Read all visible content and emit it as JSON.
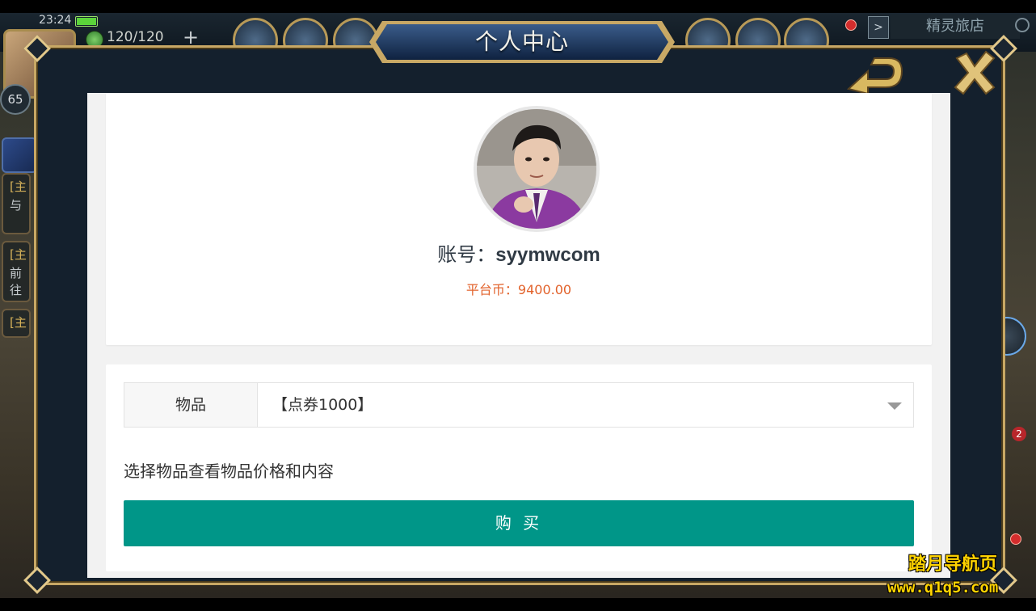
{
  "status_bar": {
    "time": "23:24",
    "stamina": "120/120",
    "plus": "+",
    "level": "65"
  },
  "game_hud": {
    "shop_name": "精灵旅店",
    "shop_arrow": ">",
    "quests": [
      {
        "tag": "[主",
        "text": "与"
      },
      {
        "tag": "[主",
        "text": "前往"
      },
      {
        "tag": "[主",
        "text": ""
      }
    ],
    "notification_count": "2"
  },
  "dialog": {
    "title": "个人中心"
  },
  "profile": {
    "account_label": "账号：",
    "account_value": "syymwcom",
    "coins_label": "平台币：",
    "coins_value": "9400.00"
  },
  "shop": {
    "item_label": "物品",
    "item_selected": "【点券1000】",
    "hint": "选择物品查看物品价格和内容",
    "buy_label": "购 买"
  },
  "watermark": {
    "line1": "踏月导航页",
    "line2": "www.q1q5.com"
  },
  "colors": {
    "buy_button": "#009688",
    "coins_text": "#e2622b",
    "frame_gold": "#c8a865",
    "dialog_bg": "#14202d",
    "watermark": "#ffd300"
  }
}
